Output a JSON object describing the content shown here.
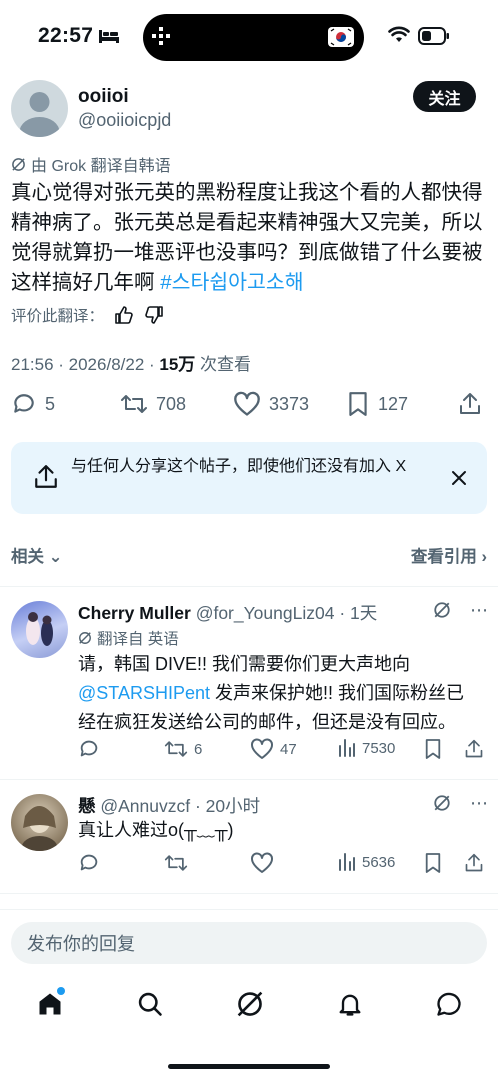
{
  "status": {
    "time": "22:57"
  },
  "tweet": {
    "author_name": "ooiioi",
    "author_handle": "@ooiioicpjd",
    "follow_label": "关注",
    "translated_label": "由 Grok 翻译自韩语",
    "body_text": "真心觉得对张元英的黑粉程度让我这个看的人都快得精神病了。张元英总是看起来精神强大又完美，所以觉得就算扔一堆恶评也没事吗？到底做错了什么要被这样搞好几年啊 ",
    "hashtag": "#스타쉽아고소해",
    "rate_label": "评价此翻译：",
    "timestamp": "21:56 · 2026/8/22 · ",
    "views": "15万",
    "views_label": " 次查看",
    "replies": "5",
    "retweets": "708",
    "likes": "3373",
    "bookmarks": "127"
  },
  "share_card": {
    "text": "与任何人分享这个帖子，即使他们还没有加入 X"
  },
  "section": {
    "related": "相关",
    "quotes": "查看引用"
  },
  "replies": [
    {
      "name": "Cherry Muller",
      "handle": "@for_YoungLiz04",
      "time": " · 1天",
      "translated": "翻译自 英语",
      "text_before": "请，韩国 DIVE!! 我们需要你们更大声地向 ",
      "mention": "@STARSHIPent",
      "text_after": " 发声来保护她!! 我们国际粉丝已经在疯狂发送给公司的邮件，但还是没有回应。",
      "retweets": "6",
      "likes": "47",
      "views": "7530"
    },
    {
      "name": "懸",
      "handle": "@Annuvzcf",
      "time": " · 20小时",
      "text": "真让人难过o(╥﹏╥)",
      "views": "5636"
    }
  ],
  "composer": {
    "placeholder": "发布你的回复"
  },
  "colors": {
    "accent": "#1d9bf0",
    "text": "#0f1419",
    "muted": "#536471",
    "card": "#e8f5fd"
  }
}
